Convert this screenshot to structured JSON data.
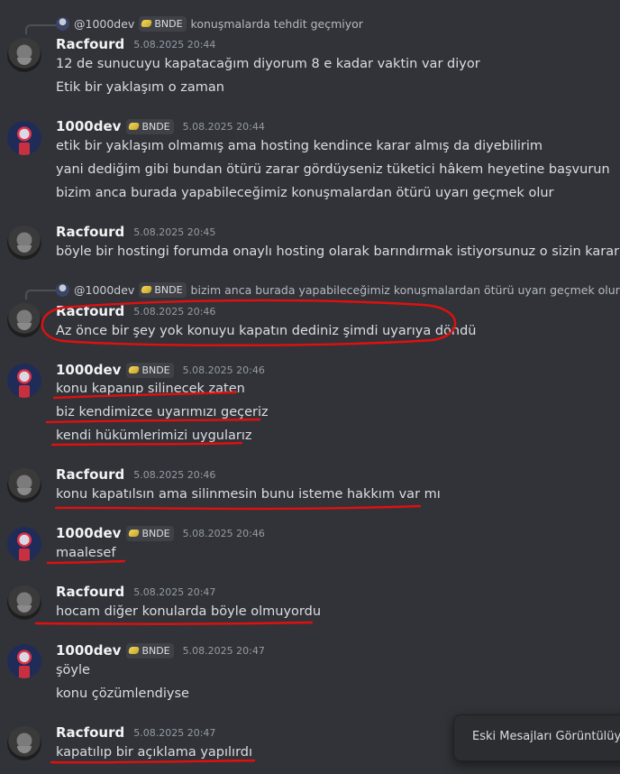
{
  "reply1": {
    "name": "@1000dev",
    "tag": "BNDE",
    "text": "konuşmalarda tehdit geçmiyor"
  },
  "msg1": {
    "user": "Racfourd",
    "time": "5.08.2025 20:44",
    "lines": [
      "12 de sunucuyu kapatacağım diyorum 8 e kadar vaktin var diyor",
      "Etik bir yaklaşım o zaman"
    ]
  },
  "msg2": {
    "user": "1000dev",
    "tag": "BNDE",
    "time": "5.08.2025 20:44",
    "lines": [
      "etik bir yaklaşım olmamış ama hosting kendince karar almış da diyebilirim",
      "yani dediğim gibi bundan ötürü zarar gördüyseniz tüketici hâkem heyetine başvurun",
      "bizim anca burada yapabileceğimiz konuşmalardan ötürü uyarı geçmek olur"
    ]
  },
  "msg3": {
    "user": "Racfourd",
    "time": "5.08.2025 20:45",
    "lines": [
      "böyle bir hostingi forumda onaylı hosting olarak barındırmak istiyorsunuz o sizin kararınız"
    ]
  },
  "reply2": {
    "name": "@1000dev",
    "tag": "BNDE",
    "text": "bizim anca burada yapabileceğimiz konuşmalardan ötürü uyarı geçmek olur"
  },
  "msg4": {
    "user": "Racfourd",
    "time": "5.08.2025 20:46",
    "lines": [
      "Az önce bir şey yok konuyu kapatın dediniz şimdi uyarıya döndü"
    ]
  },
  "msg5": {
    "user": "1000dev",
    "tag": "BNDE",
    "time": "5.08.2025 20:46",
    "lines": [
      "konu kapanıp silinecek zaten",
      "biz kendimizce uyarımızı geçeriz",
      "kendi hükümlerimizi uygularız"
    ]
  },
  "msg6": {
    "user": "Racfourd",
    "time": "5.08.2025 20:46",
    "lines": [
      "konu kapatılsın ama silinmesin bunu isteme hakkım var mı"
    ]
  },
  "msg7": {
    "user": "1000dev",
    "tag": "BNDE",
    "time": "5.08.2025 20:46",
    "lines": [
      "maalesef"
    ]
  },
  "msg8": {
    "user": "Racfourd",
    "time": "5.08.2025 20:47",
    "lines": [
      "hocam diğer konularda böyle olmuyordu"
    ]
  },
  "msg9": {
    "user": "1000dev",
    "tag": "BNDE",
    "time": "5.08.2025 20:47",
    "lines": [
      "şöyle",
      "konu çözümlendiyse"
    ]
  },
  "msg10": {
    "user": "Racfourd",
    "time": "5.08.2025 20:47",
    "lines": [
      "kapatılıp bir açıklama yapılırdı"
    ]
  },
  "toast": {
    "label": "Eski Mesajları Görüntülüyor"
  },
  "colors": {
    "background": "#313338",
    "annotation": "#e01010"
  }
}
